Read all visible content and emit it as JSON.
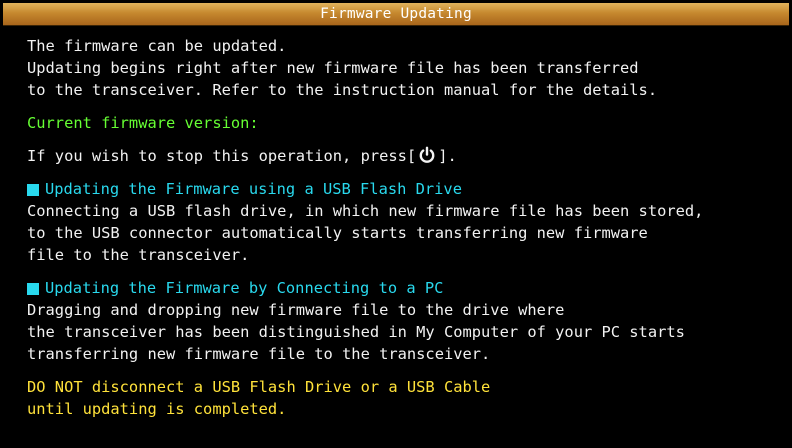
{
  "window": {
    "title": "Firmware Updating"
  },
  "intro": {
    "lines": [
      "The firmware can be updated.",
      "Updating begins right after new firmware file has been transferred",
      "to the transceiver. Refer to the instruction manual for the details."
    ]
  },
  "current_version": {
    "label": "Current firmware version:"
  },
  "stop_instruction": {
    "text_before": "If you wish to stop this operation, press",
    "bracket_open": "[",
    "bracket_close": "]",
    "text_after": ".",
    "key_icon": "power-icon"
  },
  "usb_section": {
    "heading": "Updating the Firmware using a USB Flash Drive",
    "lines": [
      "Connecting a USB flash drive, in which new firmware file has been stored,",
      "to the USB connector automatically starts transferring new firmware",
      "file to the transceiver."
    ]
  },
  "pc_section": {
    "heading": "Updating the Firmware by Connecting to a PC",
    "lines": [
      "Dragging and dropping new firmware file to the drive where",
      "the transceiver has been distinguished in My Computer of your PC starts",
      "transferring new firmware file to the transceiver."
    ]
  },
  "warning": {
    "lines": [
      "DO NOT disconnect a USB Flash Drive or a USB Cable",
      "until updating is completed."
    ]
  },
  "colors": {
    "background": "#000000",
    "title_bar": "#c6892f",
    "body_text": "#f2f2f2",
    "version_label": "#66ff33",
    "section_heading": "#29d9ee",
    "warning": "#ffe23a"
  }
}
